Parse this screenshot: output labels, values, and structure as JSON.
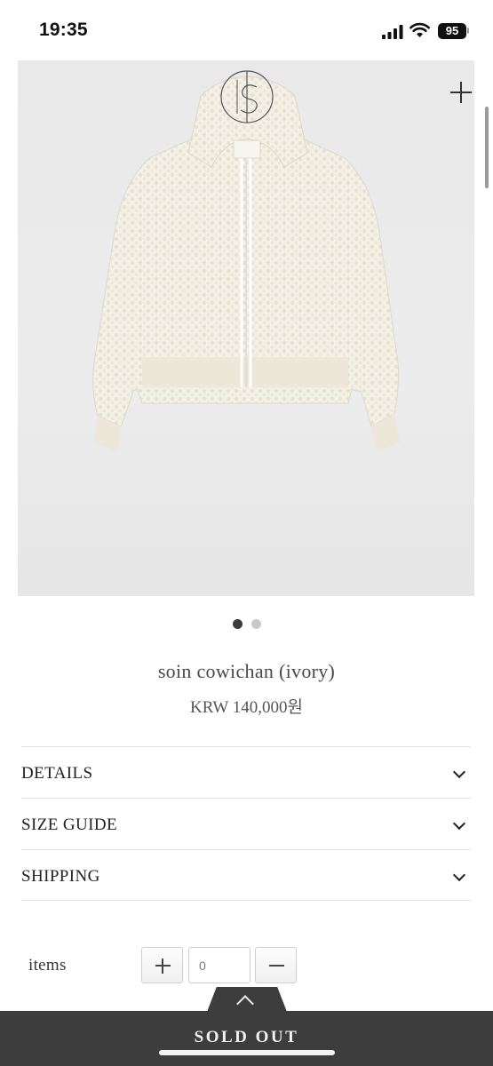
{
  "status_bar": {
    "time": "19:35",
    "battery": "95"
  },
  "product": {
    "name": "soin cowichan (ivory)",
    "price": "KRW 140,000원",
    "image_icon": "cardigan-photo",
    "carousel": {
      "total": 2,
      "active_index": 0
    }
  },
  "accordion": [
    {
      "label": "DETAILS",
      "icon": "chevron-down-icon"
    },
    {
      "label": "SIZE GUIDE",
      "icon": "chevron-down-icon"
    },
    {
      "label": "SHIPPING",
      "icon": "chevron-down-icon"
    }
  ],
  "quantity": {
    "label": "items",
    "value": "0"
  },
  "bottom_bar": {
    "button_label": "SOLD OUT"
  },
  "colors": {
    "bar": "#3d3d3d",
    "image_bg": "#e9e9e9",
    "dot_active": "#3b3b3b",
    "dot_inactive": "#c9c9c9"
  }
}
